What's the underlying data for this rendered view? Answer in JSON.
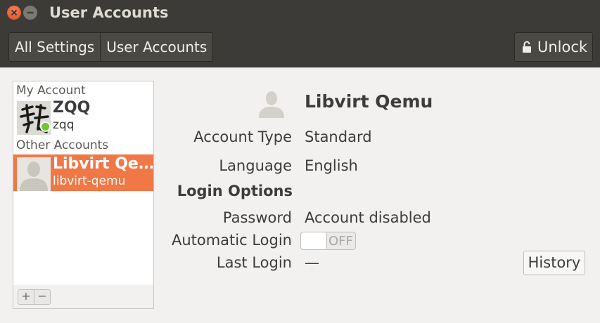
{
  "window": {
    "title": "User Accounts"
  },
  "toolbar": {
    "breadcrumb": [
      "All Settings",
      "User Accounts"
    ],
    "unlock_label": "Unlock"
  },
  "user_list": {
    "my_account_heading": "My Account",
    "other_accounts_heading": "Other Accounts",
    "users": [
      {
        "name": "ZQQ",
        "login": "zqq",
        "online": true,
        "avatar": "calligraphy-photo"
      },
      {
        "name": "Libvirt Qe…",
        "login": "libvirt-qemu",
        "selected": true,
        "avatar": "default-user-icon"
      }
    ],
    "add_label": "+",
    "remove_label": "−"
  },
  "details": {
    "full_name": "Libvirt Qemu",
    "account_type_label": "Account Type",
    "account_type_value": "Standard",
    "language_label": "Language",
    "language_value": "English",
    "login_options_heading": "Login Options",
    "password_label": "Password",
    "password_value": "Account disabled",
    "auto_login_label": "Automatic Login",
    "auto_login_state": "OFF",
    "last_login_label": "Last Login",
    "last_login_value": "—",
    "history_button": "History"
  },
  "colors": {
    "titlebar": "#3c3b37",
    "selection": "#f07746",
    "close_button": "#e95420",
    "online_dot": "#6fc733"
  }
}
